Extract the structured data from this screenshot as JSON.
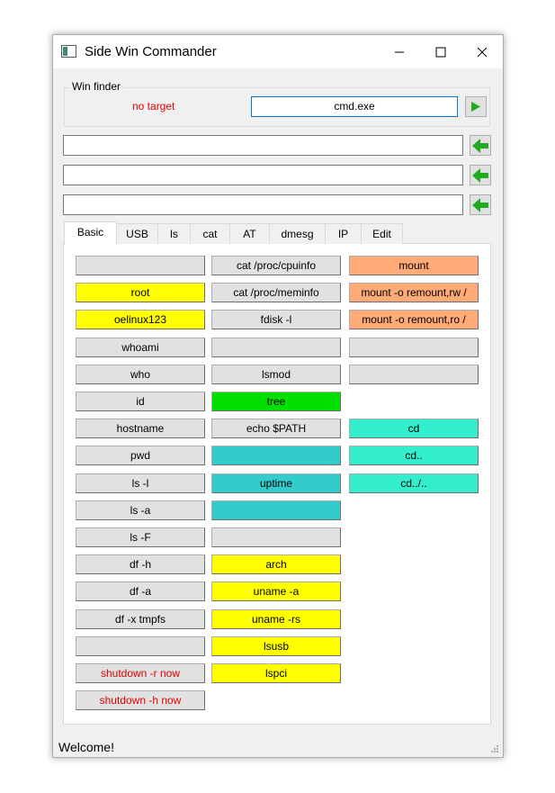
{
  "window": {
    "title": "Side Win Commander",
    "icon": "app-icon"
  },
  "titlebar_buttons": [
    "minimize-icon",
    "maximize-icon",
    "close-icon"
  ],
  "win_finder": {
    "group_title": "Win finder",
    "target_status": "no target",
    "target_input": "cmd.exe",
    "go_icon": "play-icon"
  },
  "command_fields": [
    {
      "value": "",
      "send_icon": "arrow-left-icon"
    },
    {
      "value": "",
      "send_icon": "arrow-left-icon"
    },
    {
      "value": "",
      "send_icon": "arrow-left-icon"
    }
  ],
  "tabs": [
    "Basic",
    "USB",
    "ls",
    "cat",
    "AT",
    "dmesg",
    "IP",
    "Edit"
  ],
  "active_tab": "Basic",
  "colors": {
    "gray": "#e1e1e1",
    "yellow": "#ffff00",
    "orange": "#ffaa77",
    "green": "#00e000",
    "teal": "#33cccc",
    "aqua": "#33eecc",
    "danger_text": "#e00000",
    "status_red": "#e00000",
    "arrow_green": "#22aa22"
  },
  "buttons": {
    "col1": [
      {
        "label": "",
        "color": "gray"
      },
      {
        "label": "root",
        "color": "yellow"
      },
      {
        "label": "oelinux123",
        "color": "yellow"
      },
      {
        "label": "whoami",
        "color": "gray"
      },
      {
        "label": "who",
        "color": "gray"
      },
      {
        "label": "id",
        "color": "gray"
      },
      {
        "label": "hostname",
        "color": "gray"
      },
      {
        "label": "pwd",
        "color": "gray"
      },
      {
        "label": "ls -l",
        "color": "gray"
      },
      {
        "label": "ls -a",
        "color": "gray"
      },
      {
        "label": "ls -F",
        "color": "gray"
      },
      {
        "label": "df -h",
        "color": "gray"
      },
      {
        "label": "df -a",
        "color": "gray"
      },
      {
        "label": "df -x tmpfs",
        "color": "gray"
      },
      {
        "label": "",
        "color": "gray"
      },
      {
        "label": "shutdown -r now",
        "color": "gray",
        "danger": true
      },
      {
        "label": "shutdown -h now",
        "color": "gray",
        "danger": true
      }
    ],
    "col2": [
      {
        "label": "cat /proc/cpuinfo",
        "color": "gray"
      },
      {
        "label": "cat /proc/meminfo",
        "color": "gray"
      },
      {
        "label": "fdisk -l",
        "color": "gray"
      },
      {
        "label": "",
        "color": "gray"
      },
      {
        "label": "lsmod",
        "color": "gray"
      },
      {
        "label": "tree",
        "color": "green"
      },
      {
        "label": "echo $PATH",
        "color": "gray"
      },
      {
        "label": "",
        "color": "teal"
      },
      {
        "label": "uptime",
        "color": "teal"
      },
      {
        "label": "",
        "color": "teal"
      },
      {
        "label": "",
        "color": "gray"
      },
      {
        "label": "arch",
        "color": "yellow"
      },
      {
        "label": "uname -a",
        "color": "yellow"
      },
      {
        "label": "uname -rs",
        "color": "yellow"
      },
      {
        "label": "lsusb",
        "color": "yellow"
      },
      {
        "label": "lspci",
        "color": "yellow"
      }
    ],
    "col3": [
      {
        "label": "mount",
        "color": "orange"
      },
      {
        "label": "mount -o remount,rw /",
        "color": "orange"
      },
      {
        "label": "mount -o remount,ro /",
        "color": "orange"
      },
      {
        "label": "",
        "color": "gray"
      },
      {
        "label": "",
        "color": "gray"
      },
      null,
      {
        "label": "cd",
        "color": "aqua"
      },
      {
        "label": "cd..",
        "color": "aqua"
      },
      {
        "label": "cd../..",
        "color": "aqua"
      }
    ]
  },
  "status_bar": {
    "text": "Welcome!"
  }
}
